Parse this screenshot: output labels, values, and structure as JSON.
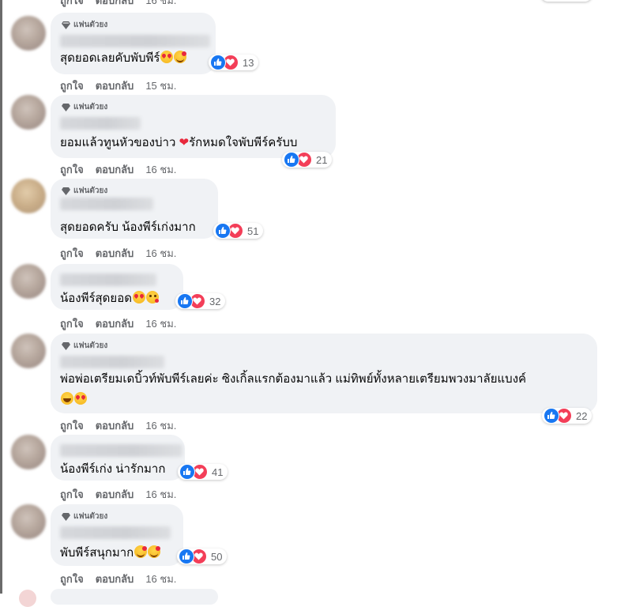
{
  "top_partial": {
    "like": "ถูกใจ",
    "reply": "ตอบกลับ",
    "time": "16 ชม."
  },
  "badge_label": "แฟนตัวยง",
  "actions": {
    "like": "ถูกใจ",
    "reply": "ตอบกลับ"
  },
  "comments": [
    {
      "badge": true,
      "text": "สุดยอดเลยคับพับพีร์",
      "emojis": [
        "heart-eyes",
        "blush"
      ],
      "reactions": "13",
      "time": "15 ชม."
    },
    {
      "badge": true,
      "text": "ยอมแล้วทูนหัวของบ่าว ",
      "text2": "รักหมดใจพับพีร์ครับบ",
      "heart": "❤",
      "reactions": "21",
      "time": "16 ชม."
    },
    {
      "badge": true,
      "text": "สุดยอดครับ น้องพีร์เก่งมาก",
      "emojis": [],
      "reactions": "51",
      "time": "16 ชม."
    },
    {
      "badge": false,
      "text": "น้องพีร์สุดยอด",
      "emojis": [
        "heart-eyes",
        "kiss"
      ],
      "reactions": "32",
      "time": "16 ชม."
    },
    {
      "badge": true,
      "text": "พ่อพ่อเตรียมเดบิ้วท์พับพีร์เลยค่ะ ซิงเกิ้ลแรกต้องมาแล้ว แม่ทิพย์ทั้งหลายเตรียมพวงมาลัยแบงค์",
      "emojis": [
        "laugh",
        "heart-eyes"
      ],
      "reactions": "22",
      "time": "16 ชม."
    },
    {
      "badge": false,
      "text": "น้องพีร์เก่ง น่ารักมาก",
      "emojis": [],
      "reactions": "41",
      "time": "16 ชม."
    },
    {
      "badge": true,
      "text": "พับพีร์สนุกมาก",
      "emojis": [
        "blush",
        "blush"
      ],
      "reactions": "50",
      "time": "16 ชม."
    }
  ]
}
